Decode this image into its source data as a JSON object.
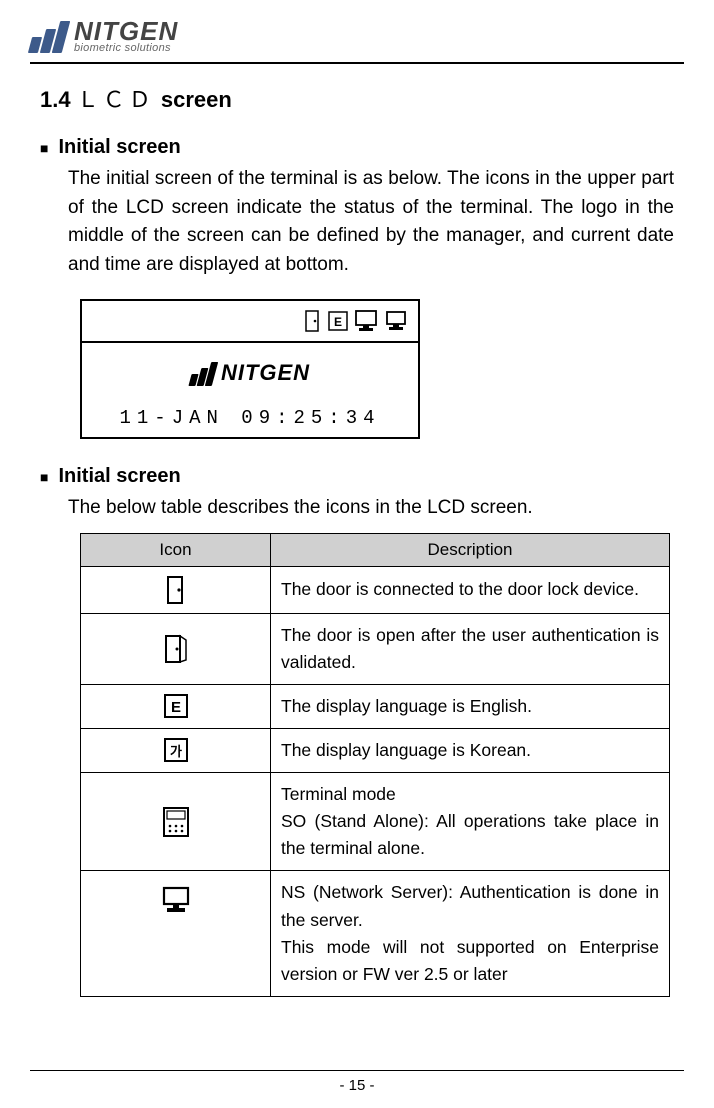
{
  "brand": {
    "name": "NITGEN",
    "sub": "biometric solutions"
  },
  "section": {
    "number": "1.4",
    "mono": "ＬＣＤ",
    "rest": "screen"
  },
  "block1": {
    "heading": "Initial screen",
    "text": "The initial screen of the terminal is as below. The icons in the upper part of the LCD screen indicate the status of the terminal. The logo in the middle of the screen can be defined by the manager, and current date and time are displayed at bottom."
  },
  "lcd": {
    "brand": "NITGEN",
    "datetime": "11-JAN 09:25:34"
  },
  "block2": {
    "heading": "Initial screen",
    "text": "The below table describes the icons in the LCD screen."
  },
  "table": {
    "head_icon": "Icon",
    "head_desc": "Description",
    "rows": [
      {
        "icon": "door-closed",
        "desc": "The door is connected to the door lock device."
      },
      {
        "icon": "door-open",
        "desc": "The door is open after the user authentication is validated."
      },
      {
        "icon": "lang-e",
        "desc": "The display language is English."
      },
      {
        "icon": "lang-k",
        "desc": "The display language is Korean."
      },
      {
        "icon": "terminal-so",
        "desc": "Terminal mode\nSO (Stand Alone): All operations take place in the terminal alone."
      },
      {
        "icon": "terminal-ns",
        "desc": "NS (Network Server): Authentication is done in the server.\nThis mode will not supported on Enterprise version or FW ver 2.5 or later"
      }
    ]
  },
  "page_number": "- 15 -"
}
